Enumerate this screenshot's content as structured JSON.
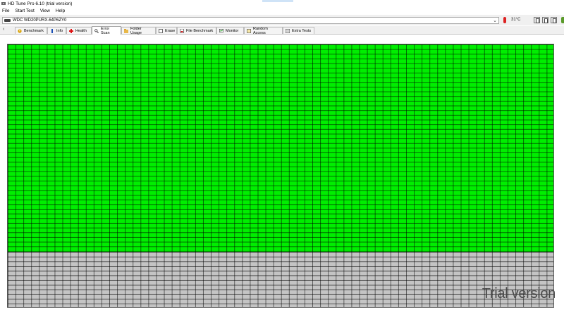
{
  "window": {
    "title": "HD Tune Pro 6.10 (trial version)"
  },
  "menu": {
    "items": [
      "File",
      "Start Test",
      "View",
      "Help"
    ]
  },
  "device": {
    "selected": "WDC WD20PURX-64P6ZY0",
    "temperature": "31°C",
    "icon": "hard-drive-icon"
  },
  "tabs": [
    {
      "label": "Benchmark",
      "icon": "benchmark-icon"
    },
    {
      "label": "Info",
      "icon": "info-icon"
    },
    {
      "label": "Health",
      "icon": "health-icon"
    },
    {
      "label": "Error Scan",
      "icon": "magnifier-icon",
      "active": true
    },
    {
      "label": "Folder Usage",
      "icon": "folder-icon"
    },
    {
      "label": "Erase",
      "icon": "erase-icon"
    },
    {
      "label": "File Benchmark",
      "icon": "file-benchmark-icon"
    },
    {
      "label": "Monitor",
      "icon": "monitor-icon"
    },
    {
      "label": "Random Access",
      "icon": "random-access-icon"
    },
    {
      "label": "Extra Tests",
      "icon": "extra-tests-icon"
    }
  ],
  "scan": {
    "scanned_fraction": 0.79,
    "block_colors": {
      "ok": "#00ee00",
      "pending": "#c4c4c4"
    }
  },
  "watermark": "Trial version"
}
